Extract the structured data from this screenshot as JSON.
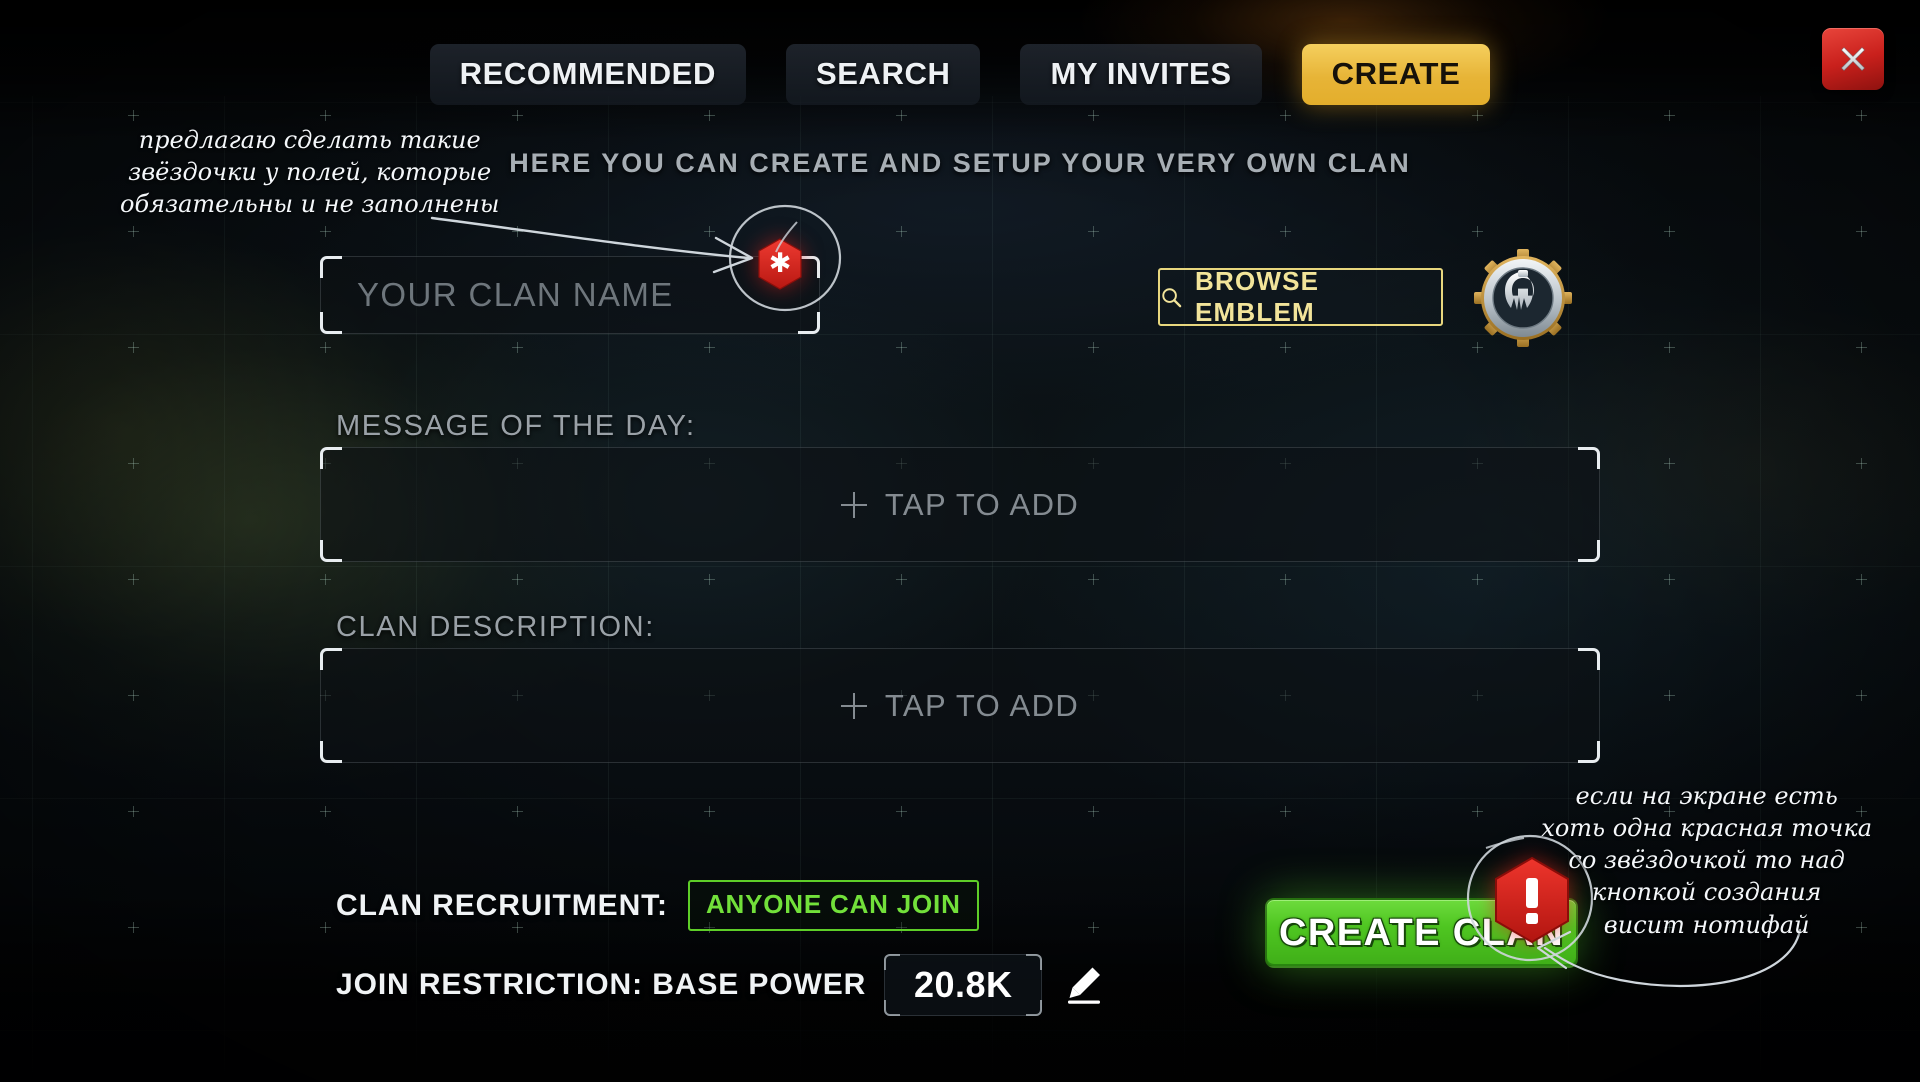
{
  "window": {
    "close_icon": "close-icon"
  },
  "topnav": {
    "tabs": [
      {
        "label": "RECOMMENDED",
        "active": false
      },
      {
        "label": "SEARCH",
        "active": false
      },
      {
        "label": "MY INVITES",
        "active": false
      },
      {
        "label": "CREATE",
        "active": true
      }
    ]
  },
  "header": {
    "subtitle": "HERE YOU CAN CREATE AND SETUP YOUR VERY OWN CLAN"
  },
  "form": {
    "clan_name": {
      "value": "",
      "placeholder": "YOUR CLAN NAME",
      "required_badge": "*"
    },
    "browse_emblem": {
      "label": "BROWSE EMBLEM",
      "icon": "search-icon"
    },
    "emblem": {
      "icon": "spartan-helmet-gear-emblem"
    },
    "motd": {
      "label": "MESSAGE OF THE DAY:",
      "placeholder": "TAP TO ADD",
      "plus_icon": "plus-icon"
    },
    "description": {
      "label": "CLAN DESCRIPTION:",
      "placeholder": "TAP TO ADD",
      "plus_icon": "plus-icon"
    },
    "recruitment": {
      "label": "CLAN RECRUITMENT:",
      "value": "ANYONE CAN JOIN"
    },
    "join_restriction": {
      "label": "JOIN RESTRICTION: BASE POWER",
      "value": "20.8K",
      "edit_icon": "pencil-icon"
    }
  },
  "actions": {
    "create_clan": {
      "label": "CREATE CLAN",
      "alert_badge": "!"
    }
  },
  "annotations": {
    "left": {
      "lines": [
        "предлагаю сделать такие",
        "звёздочки у полей, которые",
        "обязательны и не заполнены"
      ]
    },
    "right": {
      "lines": [
        "если на экране есть",
        "хоть одна красная точка",
        "со звёздочкой то над",
        "кнопкой создания",
        "висит нотифай"
      ]
    }
  },
  "colors": {
    "accent_yellow": "#e7b437",
    "accent_green": "#4fc621",
    "badge_red": "#d9251f",
    "close_red": "#c9201c",
    "emblem_outline": "#e8d77e",
    "text_primary": "#f0f3f5",
    "text_muted": "#9aa1a7",
    "placeholder": "#6e767c"
  }
}
